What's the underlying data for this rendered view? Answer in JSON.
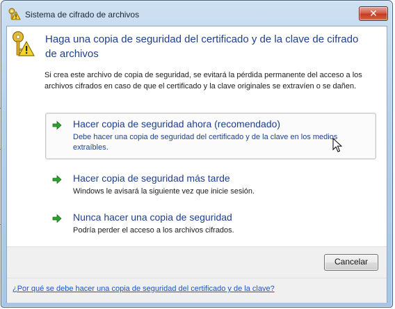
{
  "window": {
    "title": "Sistema de cifrado de archivos",
    "close_symbol": "✕",
    "icons": {
      "title": "key-warning-icon",
      "close": "close-icon"
    }
  },
  "header": {
    "title": "Haga una copia de seguridad del certificado y de la clave de cifrado de archivos",
    "icon": "key-warning-icon"
  },
  "intro_text": "Si crea este archivo de copia de seguridad, se evitará la pérdida permanente del acceso a los archivos cifrados en caso de que el certificado y la clave originales se extravíen o se dañen.",
  "options": [
    {
      "title": "Hacer copia de seguridad ahora (recomendado)",
      "description": "Debe hacer una copia de seguridad del certificado y de la clave en los medios extraíbles.",
      "icon": "green-arrow-icon"
    },
    {
      "title": "Hacer copia de seguridad más tarde",
      "description": "Windows le avisará la siguiente vez que inicie sesión.",
      "icon": "green-arrow-icon"
    },
    {
      "title": "Nunca hacer una copia de seguridad",
      "description": "Podría perder el acceso a los archivos cifrados.",
      "icon": "green-arrow-icon"
    }
  ],
  "buttons": {
    "cancel": "Cancelar"
  },
  "footer": {
    "help_link": "¿Por qué se debe hacer una copia de seguridad del certificado y de la clave?"
  },
  "colors": {
    "title_blue": "#1e3f8c",
    "link_blue": "#1c54c4",
    "arrow_green": "#2fa12f",
    "close_red": "#c5391f"
  }
}
